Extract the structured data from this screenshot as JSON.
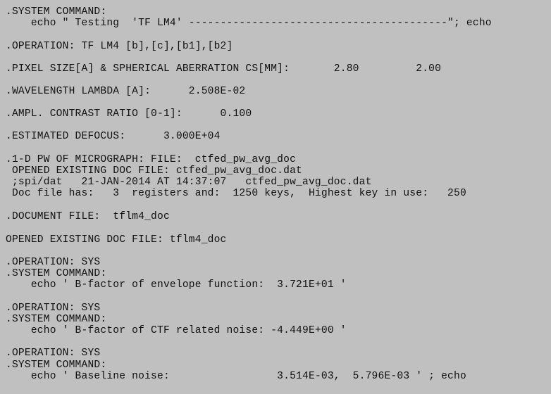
{
  "window": {
    "background": "#c0c0c0",
    "text_color": "#101010"
  },
  "terminal": {
    "lines": [
      ".SYSTEM COMMAND:",
      "    echo \" Testing  'TF LM4' -----------------------------------------\"; echo",
      ".OPERATION: TF LM4 [b],[c],[b1],[b2]",
      ".PIXEL SIZE[A] & SPHERICAL ABERRATION CS[MM]:       2.80         2.00",
      ".WAVELENGTH LAMBDA [A]:      2.508E-02",
      ".AMPL. CONTRAST RATIO [0-1]:      0.100",
      ".ESTIMATED DEFOCUS:      3.000E+04",
      ".1-D PW OF MICROGRAPH: FILE:  ctfed_pw_avg_doc",
      " OPENED EXISTING DOC FILE: ctfed_pw_avg_doc.dat",
      " ;spi/dat   21-JAN-2014 AT 14:37:07   ctfed_pw_avg_doc.dat",
      " Doc file has:   3  registers and:  1250 keys,  Highest key in use:   250",
      ".DOCUMENT FILE:  tflm4_doc",
      "OPENED EXISTING DOC FILE: tflm4_doc",
      ".OPERATION: SYS",
      ".SYSTEM COMMAND:",
      "    echo ' B-factor of envelope function:  3.721E+01 '",
      ".OPERATION: SYS",
      ".SYSTEM COMMAND:",
      "    echo ' B-factor of CTF related noise: -4.449E+00 '",
      ".OPERATION: SYS",
      ".SYSTEM COMMAND:",
      "    echo ' Baseline noise:                 3.514E-03,  5.796E-03 ' ; echo"
    ]
  }
}
